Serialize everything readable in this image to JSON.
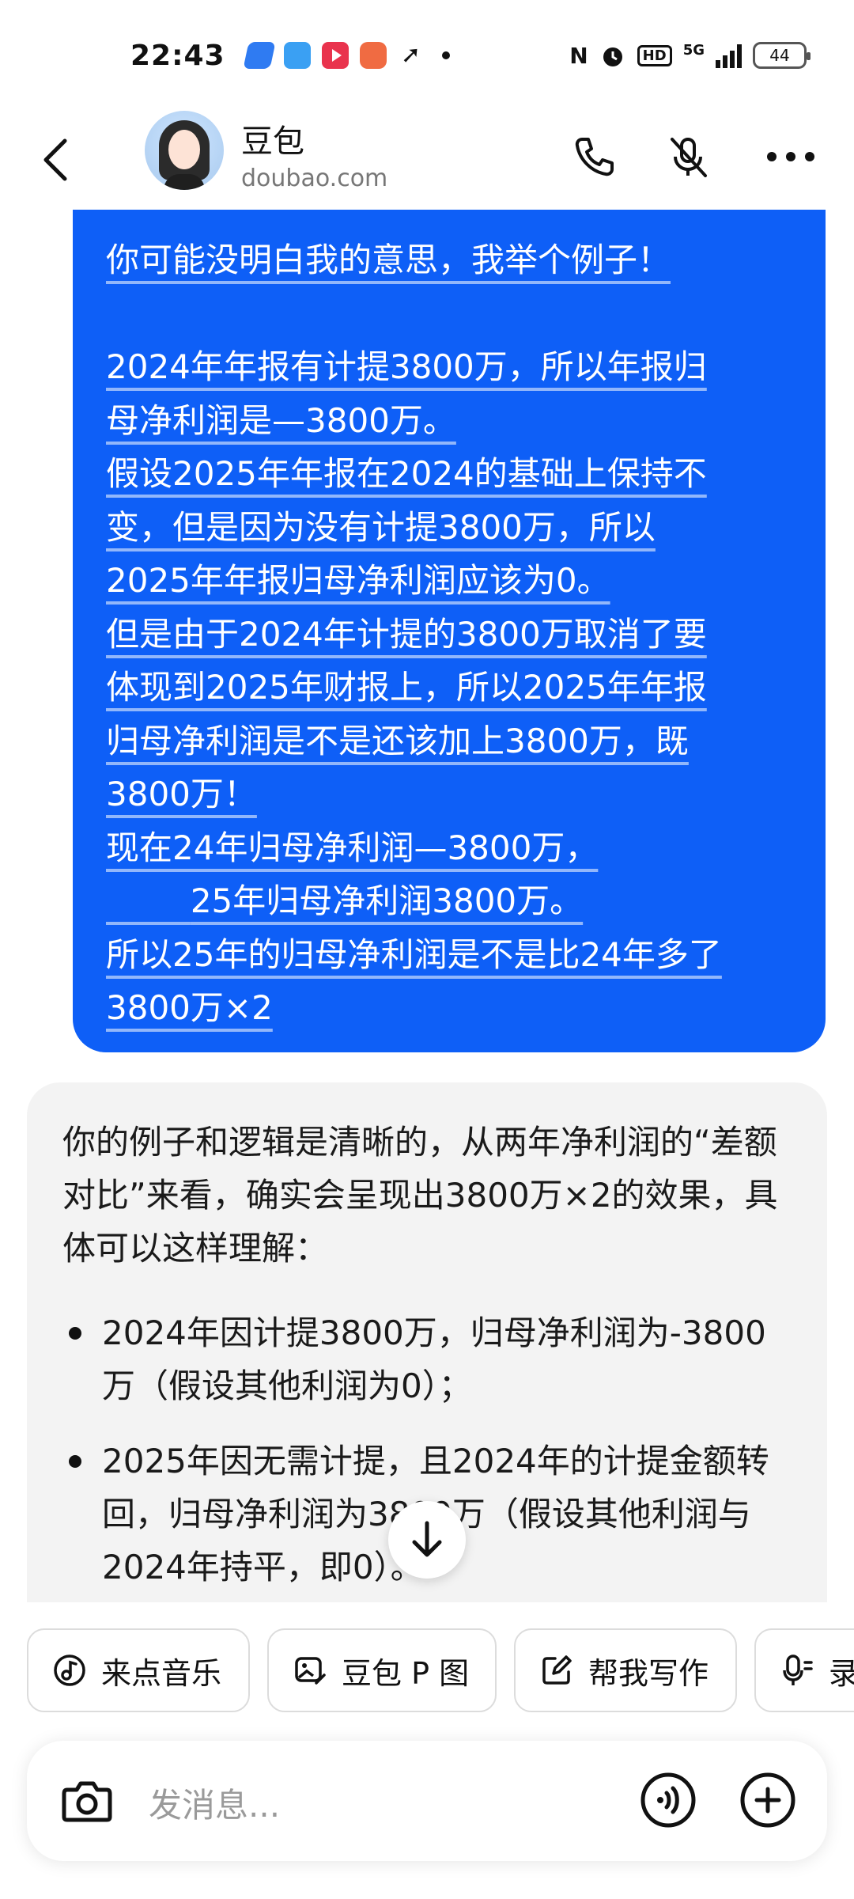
{
  "status_bar": {
    "time": "22:43",
    "notif_icons": [
      "app-icon",
      "weather-icon",
      "video-icon",
      "game-icon",
      "plane-icon"
    ],
    "nfc": "N",
    "hd": "HD",
    "network": "5G",
    "battery": "44"
  },
  "header": {
    "bot_name": "豆包",
    "bot_domain": "doubao.com"
  },
  "user_message": {
    "lines": [
      "你可能没明白我的意思，我举个例子！",
      "",
      "2024年年报有计提3800万，所以年报归",
      "母净利润是—3800万。",
      "假设2025年年报在2024的基础上保持不",
      "变，但是因为没有计提3800万，所以",
      "2025年年报归母净利润应该为0。",
      "但是由于2024年计提的3800万取消了要",
      "体现到2025年财报上，所以2025年年报",
      "归母净利润是不是还该加上3800万，既",
      "3800万！",
      "现在24年归母净利润—3800万，",
      "        25年归母净利润3800万。",
      "所以25年的归母净利润是不是比24年多了",
      "3800万×2"
    ]
  },
  "ai_message": {
    "intro": "你的例子和逻辑是清晰的，从两年净利润的“差额对比”来看，确实会呈现出3800万×2的效果，具体可以这样理解：",
    "bullets": [
      "2024年因计提3800万，归母净利润为-3800万（假设其他利润为0）；",
      "2025年因无需计提，且2024年的计提金额转回，归母净利润为3800万（假设其他利润与2024年持平，即0）。"
    ]
  },
  "chips": [
    "来点音乐",
    "豆包 P 图",
    "帮我写作",
    "录音"
  ],
  "input": {
    "placeholder": "发消息..."
  },
  "colors": {
    "user_bubble": "#0e5ff7",
    "ai_bubble": "#f3f3f3",
    "text": "#111111"
  }
}
